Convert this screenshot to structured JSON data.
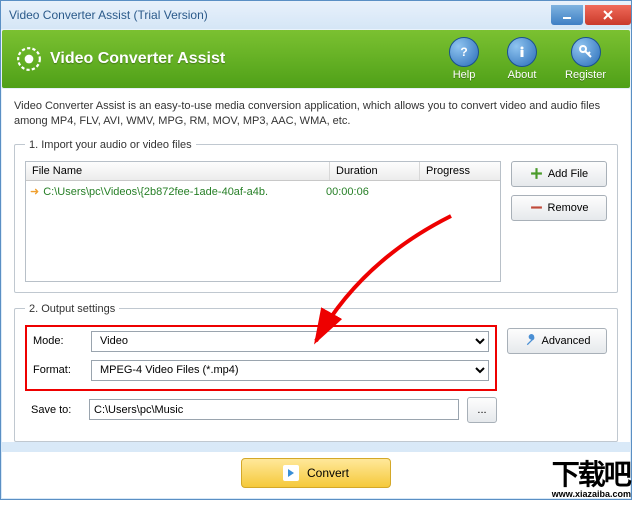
{
  "window": {
    "title": "Video Converter Assist (Trial Version)"
  },
  "header": {
    "app_name": "Video Converter Assist",
    "buttons": {
      "help": "Help",
      "about": "About",
      "register": "Register"
    }
  },
  "description": "Video Converter Assist is an easy-to-use media conversion application, which allows you to convert video and audio files among MP4, FLV, AVI, WMV, MPG, RM, MOV, MP3, AAC, WMA, etc.",
  "import": {
    "legend": "1. Import your audio or video files",
    "columns": {
      "name": "File Name",
      "duration": "Duration",
      "progress": "Progress"
    },
    "rows": [
      {
        "name": "C:\\Users\\pc\\Videos\\{2b872fee-1ade-40af-a4b.",
        "duration": "00:00:06",
        "progress": ""
      }
    ],
    "add_label": "Add File",
    "remove_label": "Remove"
  },
  "output": {
    "legend": "2. Output settings",
    "mode_label": "Mode:",
    "mode_value": "Video",
    "format_label": "Format:",
    "format_value": "MPEG-4 Video Files (*.mp4)",
    "saveto_label": "Save to:",
    "saveto_value": "C:\\Users\\pc\\Music",
    "advanced_label": "Advanced",
    "browse_label": "..."
  },
  "convert": {
    "label": "Convert"
  },
  "watermark": {
    "main": "下载吧",
    "sub": "www.xiazaiba.com"
  }
}
